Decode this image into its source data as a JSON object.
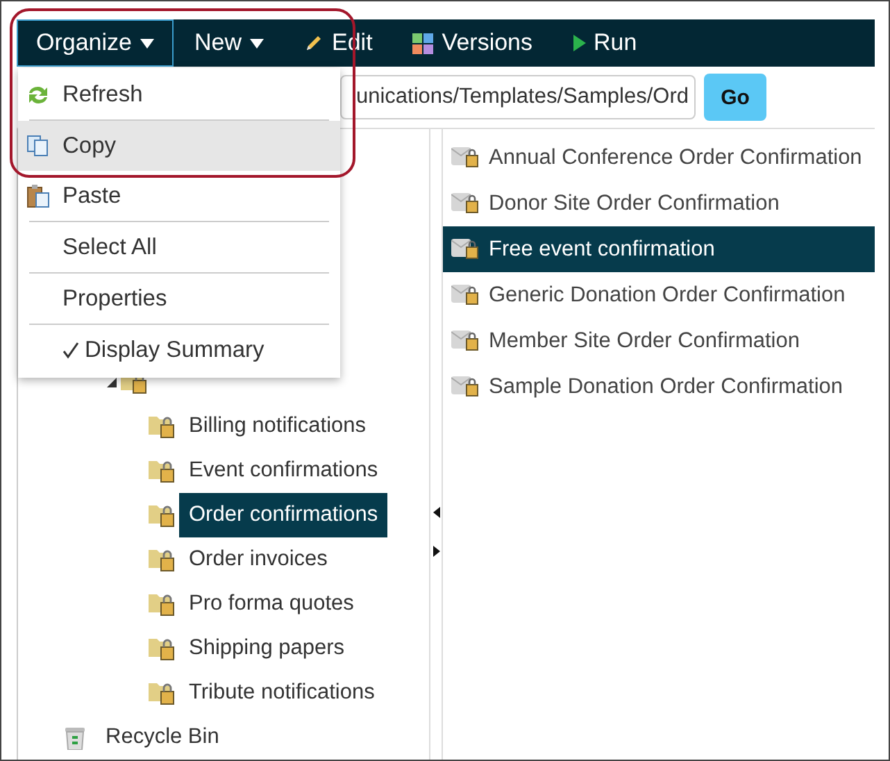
{
  "toolbar": {
    "items": [
      {
        "label": "Organize",
        "kind": "dropdown",
        "selected": true
      },
      {
        "label": "New",
        "kind": "dropdown",
        "selected": false
      },
      {
        "label": "Edit",
        "kind": "edit",
        "selected": false
      },
      {
        "label": "Versions",
        "kind": "versions",
        "selected": false
      },
      {
        "label": "Run",
        "kind": "run",
        "selected": false
      }
    ]
  },
  "path_bar": {
    "value": "unications/Templates/Samples/Ord",
    "button": "Go"
  },
  "menu": {
    "items": [
      {
        "label": "Refresh",
        "kind": "refresh",
        "highlighted": false,
        "checked": false,
        "separator_after": true
      },
      {
        "label": "Copy",
        "kind": "copy",
        "highlighted": true,
        "checked": false,
        "separator_after": false
      },
      {
        "label": "Paste",
        "kind": "paste",
        "highlighted": false,
        "checked": false,
        "separator_after": true
      },
      {
        "label": "Select All",
        "kind": "plain",
        "highlighted": false,
        "checked": false,
        "separator_after": true
      },
      {
        "label": "Properties",
        "kind": "plain",
        "highlighted": false,
        "checked": false,
        "separator_after": true
      },
      {
        "label": "Display Summary",
        "kind": "plain",
        "highlighted": false,
        "checked": true,
        "separator_after": false
      }
    ]
  },
  "tree": {
    "items": [
      {
        "kind": "folder",
        "expanded": true,
        "selected": false,
        "children": [
          {
            "label": "Billing notifications",
            "kind": "folder",
            "selected": false
          },
          {
            "label": "Event confirmations",
            "kind": "folder",
            "selected": false
          },
          {
            "label": "Order confirmations",
            "kind": "folder",
            "selected": true
          },
          {
            "label": "Order invoices",
            "kind": "folder",
            "selected": false
          },
          {
            "label": "Pro forma quotes",
            "kind": "folder",
            "selected": false
          },
          {
            "label": "Shipping papers",
            "kind": "folder",
            "selected": false
          },
          {
            "label": "Tribute notifications",
            "kind": "folder",
            "selected": false
          }
        ]
      },
      {
        "label": "Recycle Bin",
        "kind": "recycle",
        "selected": false
      }
    ]
  },
  "list": {
    "items": [
      {
        "label": "Annual Conference Order Confirmation",
        "selected": false
      },
      {
        "label": "Donor Site Order Confirmation",
        "selected": false
      },
      {
        "label": "Free event confirmation",
        "selected": true
      },
      {
        "label": "Generic Donation Order Confirmation",
        "selected": false
      },
      {
        "label": "Member Site Order Confirmation",
        "selected": false
      },
      {
        "label": "Sample Donation Order Confirmation",
        "selected": false
      }
    ]
  }
}
